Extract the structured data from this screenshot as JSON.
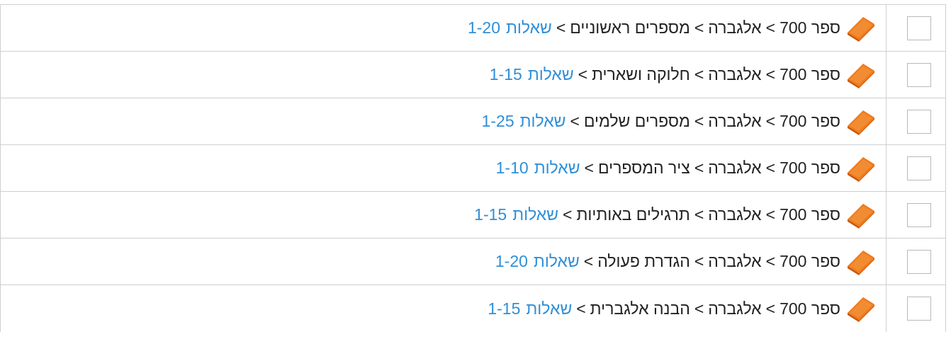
{
  "separator": ">",
  "rows": [
    {
      "book": "ספר 700",
      "subject": "אלגברה",
      "topic": "מספרים ראשוניים",
      "questions_label": "שאלות",
      "questions_range": "1-20"
    },
    {
      "book": "ספר 700",
      "subject": "אלגברה",
      "topic": "חלוקה ושארית",
      "questions_label": "שאלות",
      "questions_range": "1-15"
    },
    {
      "book": "ספר 700",
      "subject": "אלגברה",
      "topic": "מספרים שלמים",
      "questions_label": "שאלות",
      "questions_range": "1-25"
    },
    {
      "book": "ספר 700",
      "subject": "אלגברה",
      "topic": "ציר המספרים",
      "questions_label": "שאלות",
      "questions_range": "1-10"
    },
    {
      "book": "ספר 700",
      "subject": "אלגברה",
      "topic": "תרגילים באותיות",
      "questions_label": "שאלות",
      "questions_range": "1-15"
    },
    {
      "book": "ספר 700",
      "subject": "אלגברה",
      "topic": "הגדרת פעולה",
      "questions_label": "שאלות",
      "questions_range": "1-20"
    },
    {
      "book": "ספר 700",
      "subject": "אלגברה",
      "topic": "הבנה אלגברית",
      "questions_label": "שאלות",
      "questions_range": "1-15"
    }
  ],
  "icon": {
    "name": "book-icon",
    "color": "#f07a1a",
    "shade": "#c9560a"
  },
  "link_color": "#2f8fd8"
}
